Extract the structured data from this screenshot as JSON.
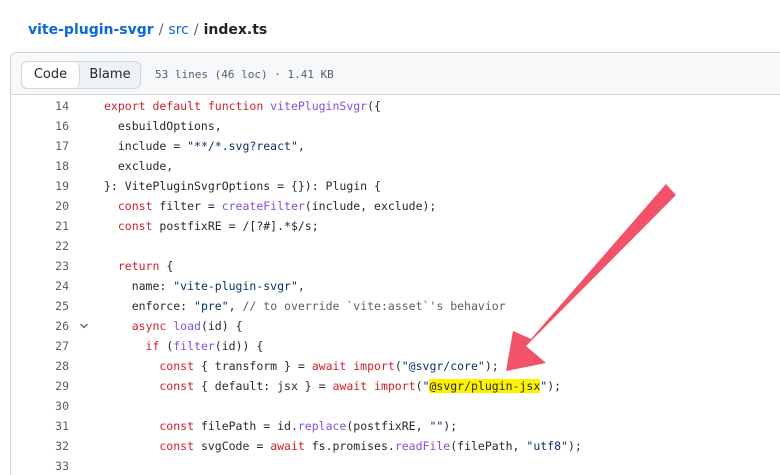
{
  "breadcrumb": {
    "repo": "vite-plugin-svgr",
    "sep1": "/",
    "dir": "src",
    "sep2": "/",
    "file": "index.ts"
  },
  "toolbar": {
    "code_label": "Code",
    "blame_label": "Blame",
    "file_meta": "53 lines (46 loc) · 1.41 KB"
  },
  "code_lines": [
    {
      "num": "14",
      "tokens": [
        [
          "kw",
          "export default function "
        ],
        [
          "fn",
          "vitePluginSvgr"
        ],
        [
          "",
          "({"
        ]
      ]
    },
    {
      "num": "16",
      "tokens": [
        [
          "",
          "  esbuildOptions,"
        ]
      ]
    },
    {
      "num": "17",
      "tokens": [
        [
          "",
          "  include = "
        ],
        [
          "str",
          "\"**/*.svg?react\""
        ],
        [
          "",
          ","
        ]
      ]
    },
    {
      "num": "18",
      "tokens": [
        [
          "",
          "  exclude,"
        ]
      ]
    },
    {
      "num": "19",
      "tokens": [
        [
          "",
          "}: VitePluginSvgrOptions = {}): Plugin {"
        ]
      ]
    },
    {
      "num": "20",
      "tokens": [
        [
          "kw",
          "  const "
        ],
        [
          "",
          "filter = "
        ],
        [
          "fn",
          "createFilter"
        ],
        [
          "",
          "(include, exclude);"
        ]
      ]
    },
    {
      "num": "21",
      "tokens": [
        [
          "kw",
          "  const "
        ],
        [
          "",
          "postfixRE = /[?#].*$/s;"
        ]
      ]
    },
    {
      "num": "22",
      "tokens": [
        [
          "",
          ""
        ]
      ]
    },
    {
      "num": "23",
      "tokens": [
        [
          "kw",
          "  return "
        ],
        [
          "",
          "{"
        ]
      ]
    },
    {
      "num": "24",
      "tokens": [
        [
          "",
          "    name: "
        ],
        [
          "str",
          "\"vite-plugin-svgr\""
        ],
        [
          "",
          ","
        ]
      ]
    },
    {
      "num": "25",
      "tokens": [
        [
          "",
          "    enforce: "
        ],
        [
          "str",
          "\"pre\""
        ],
        [
          "",
          ", "
        ],
        [
          "cm",
          "// to override `vite:asset`'s behavior"
        ]
      ]
    },
    {
      "num": "26",
      "fold": true,
      "tokens": [
        [
          "kw",
          "    async "
        ],
        [
          "fn",
          "load"
        ],
        [
          "",
          "(id) {"
        ]
      ]
    },
    {
      "num": "27",
      "tokens": [
        [
          "kw",
          "      if "
        ],
        [
          "",
          "("
        ],
        [
          "fn",
          "filter"
        ],
        [
          "",
          "(id)) {"
        ]
      ]
    },
    {
      "num": "28",
      "tokens": [
        [
          "kw",
          "        const "
        ],
        [
          "",
          "{ transform } = "
        ],
        [
          "kw",
          "await import"
        ],
        [
          "",
          "("
        ],
        [
          "str",
          "\"@svgr/core\""
        ],
        [
          "",
          ");"
        ]
      ]
    },
    {
      "num": "29",
      "tokens": [
        [
          "kw",
          "        const "
        ],
        [
          "",
          "{ default: jsx } = "
        ],
        [
          "kw",
          "await import"
        ],
        [
          "",
          "("
        ],
        [
          "str",
          "\""
        ],
        [
          "hl",
          "@svgr/plugin-jsx"
        ],
        [
          "str",
          "\""
        ],
        [
          "",
          ");"
        ]
      ]
    },
    {
      "num": "30",
      "tokens": [
        [
          "",
          ""
        ]
      ]
    },
    {
      "num": "31",
      "tokens": [
        [
          "kw",
          "        const "
        ],
        [
          "",
          "filePath = id."
        ],
        [
          "fn",
          "replace"
        ],
        [
          "",
          "(postfixRE, "
        ],
        [
          "str",
          "\"\""
        ],
        [
          "",
          ");"
        ]
      ]
    },
    {
      "num": "32",
      "tokens": [
        [
          "kw",
          "        const "
        ],
        [
          "",
          "svgCode = "
        ],
        [
          "kw",
          "await "
        ],
        [
          "",
          "fs.promises."
        ],
        [
          "fn",
          "readFile"
        ],
        [
          "",
          "(filePath, "
        ],
        [
          "str",
          "\"utf8\""
        ],
        [
          "",
          ");"
        ]
      ]
    },
    {
      "num": "33",
      "tokens": [
        [
          "",
          ""
        ]
      ]
    }
  ],
  "icons": {
    "fold": "chevron-down-icon",
    "annotation": "red-arrow-annotation"
  },
  "colors": {
    "link": "#0969da",
    "keyword": "#cf222e",
    "function": "#8250df",
    "string": "#0a3069",
    "highlight": "#fff200",
    "arrow": "#f0445e"
  }
}
